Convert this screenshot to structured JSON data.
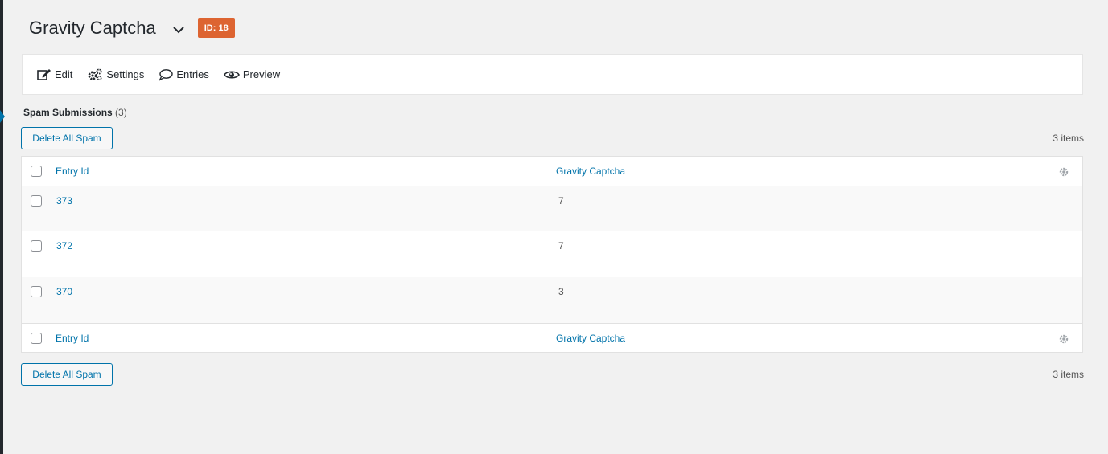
{
  "header": {
    "title": "Gravity Captcha",
    "id_badge": "ID: 18"
  },
  "toolbar": {
    "edit": "Edit",
    "settings": "Settings",
    "entries": "Entries",
    "preview": "Preview"
  },
  "section": {
    "title": "Spam Submissions",
    "count": "(3)"
  },
  "actions": {
    "delete_all": "Delete All Spam",
    "items_count": "3 items"
  },
  "table": {
    "columns": [
      "Entry Id",
      "Gravity Captcha"
    ],
    "rows": [
      {
        "id": "373",
        "value": "7"
      },
      {
        "id": "372",
        "value": "7"
      },
      {
        "id": "370",
        "value": "3"
      }
    ]
  },
  "colors": {
    "accent": "#0073aa",
    "badge": "#dd6431",
    "admin_bar": "#23282d"
  }
}
